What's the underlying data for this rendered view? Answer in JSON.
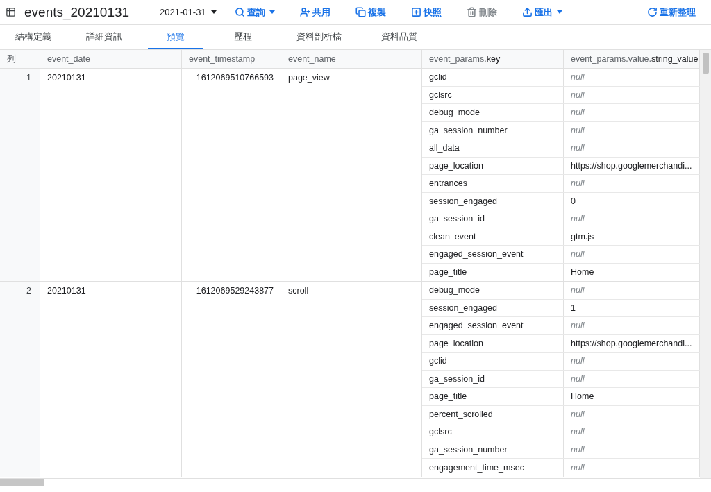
{
  "toolbar": {
    "title": "events_20210131",
    "date": "2021-01-31",
    "actions": [
      {
        "kind": "search",
        "label": "查詢",
        "caret": true,
        "disabled": false
      },
      {
        "kind": "share",
        "label": "共用",
        "caret": false,
        "disabled": false
      },
      {
        "kind": "copy",
        "label": "複製",
        "caret": false,
        "disabled": false
      },
      {
        "kind": "snapshot",
        "label": "快照",
        "caret": false,
        "disabled": false
      },
      {
        "kind": "delete",
        "label": "刪除",
        "caret": false,
        "disabled": true
      },
      {
        "kind": "export",
        "label": "匯出",
        "caret": true,
        "disabled": false
      }
    ],
    "refresh": "重新整理"
  },
  "tabs": [
    {
      "label": "結構定義",
      "selected": false
    },
    {
      "label": "詳細資訊",
      "selected": false
    },
    {
      "label": "預覽",
      "selected": true
    },
    {
      "label": "歷程",
      "selected": false
    },
    {
      "label": "資料剖析檔",
      "selected": false
    },
    {
      "label": "資料品質",
      "selected": false
    }
  ],
  "table": {
    "columns": [
      "列",
      "event_date",
      "event_timestamp",
      "event_name",
      "event_params.**key**",
      "event_params.value.**string_value**"
    ],
    "rows": [
      {
        "row": "1",
        "event_date": "20210131",
        "event_timestamp": "1612069510766593",
        "event_name": "page_view",
        "params": [
          {
            "key": "gclid",
            "value": "null",
            "is_null": true
          },
          {
            "key": "gclsrc",
            "value": "null",
            "is_null": true
          },
          {
            "key": "debug_mode",
            "value": "null",
            "is_null": true
          },
          {
            "key": "ga_session_number",
            "value": "null",
            "is_null": true
          },
          {
            "key": "all_data",
            "value": "null",
            "is_null": true
          },
          {
            "key": "page_location",
            "value": "https://shop.googlemerchandi...",
            "is_null": false
          },
          {
            "key": "entrances",
            "value": "null",
            "is_null": true
          },
          {
            "key": "session_engaged",
            "value": "0",
            "is_null": false
          },
          {
            "key": "ga_session_id",
            "value": "null",
            "is_null": true
          },
          {
            "key": "clean_event",
            "value": "gtm.js",
            "is_null": false
          },
          {
            "key": "engaged_session_event",
            "value": "null",
            "is_null": true
          },
          {
            "key": "page_title",
            "value": "Home",
            "is_null": false
          }
        ]
      },
      {
        "row": "2",
        "event_date": "20210131",
        "event_timestamp": "1612069529243877",
        "event_name": "scroll",
        "params": [
          {
            "key": "debug_mode",
            "value": "null",
            "is_null": true
          },
          {
            "key": "session_engaged",
            "value": "1",
            "is_null": false
          },
          {
            "key": "engaged_session_event",
            "value": "null",
            "is_null": true
          },
          {
            "key": "page_location",
            "value": "https://shop.googlemerchandi...",
            "is_null": false
          },
          {
            "key": "gclid",
            "value": "null",
            "is_null": true
          },
          {
            "key": "ga_session_id",
            "value": "null",
            "is_null": true
          },
          {
            "key": "page_title",
            "value": "Home",
            "is_null": false
          },
          {
            "key": "percent_scrolled",
            "value": "null",
            "is_null": true
          },
          {
            "key": "gclsrc",
            "value": "null",
            "is_null": true
          },
          {
            "key": "ga_session_number",
            "value": "null",
            "is_null": true
          },
          {
            "key": "engagement_time_msec",
            "value": "null",
            "is_null": true
          }
        ]
      }
    ]
  }
}
